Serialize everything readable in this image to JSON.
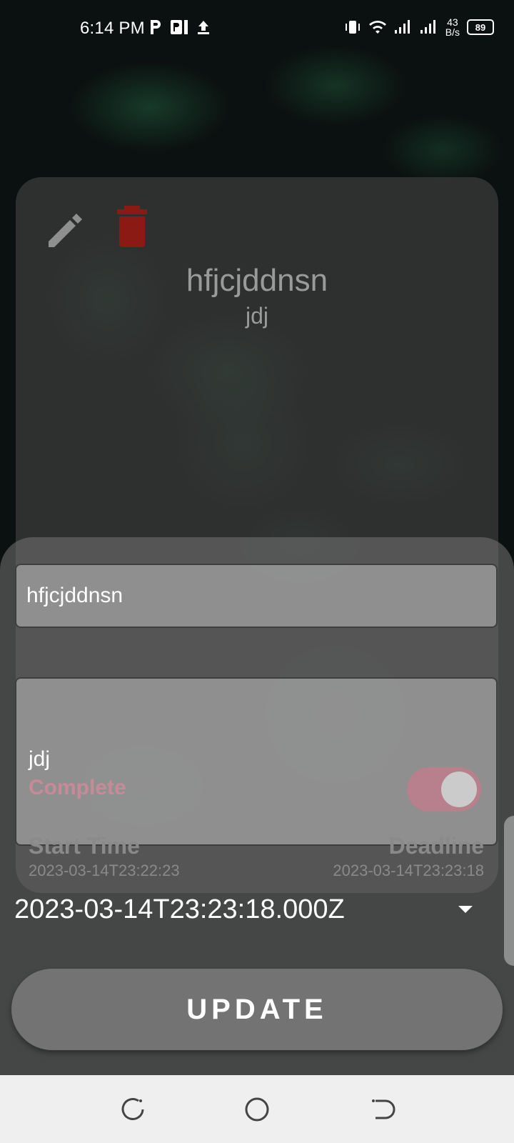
{
  "status_bar": {
    "time": "6:14 PM",
    "net_speed_value": "43",
    "net_speed_unit": "B/s",
    "battery": "89"
  },
  "task_card": {
    "title": "hfjcjddnsn",
    "description": "jdj",
    "edit_icon": "pencil-icon",
    "delete_icon": "trash-icon",
    "delete_color": "#8b1a14"
  },
  "edit_form": {
    "title_value": "hfjcjddnsn",
    "description_value": "jdj",
    "complete_label": "Complete",
    "complete_on": true,
    "start_label": "Start Time",
    "start_value": "2023-03-14T23:22:23",
    "deadline_label": "Deadline",
    "deadline_value": "2023-03-14T23:23:18",
    "deadline_select_value": "2023-03-14T23:23:18.000Z",
    "update_label": "UPDATE"
  },
  "nav_bar": {
    "back_icon": "back-icon",
    "home_icon": "home-icon",
    "recents_icon": "recents-icon"
  }
}
